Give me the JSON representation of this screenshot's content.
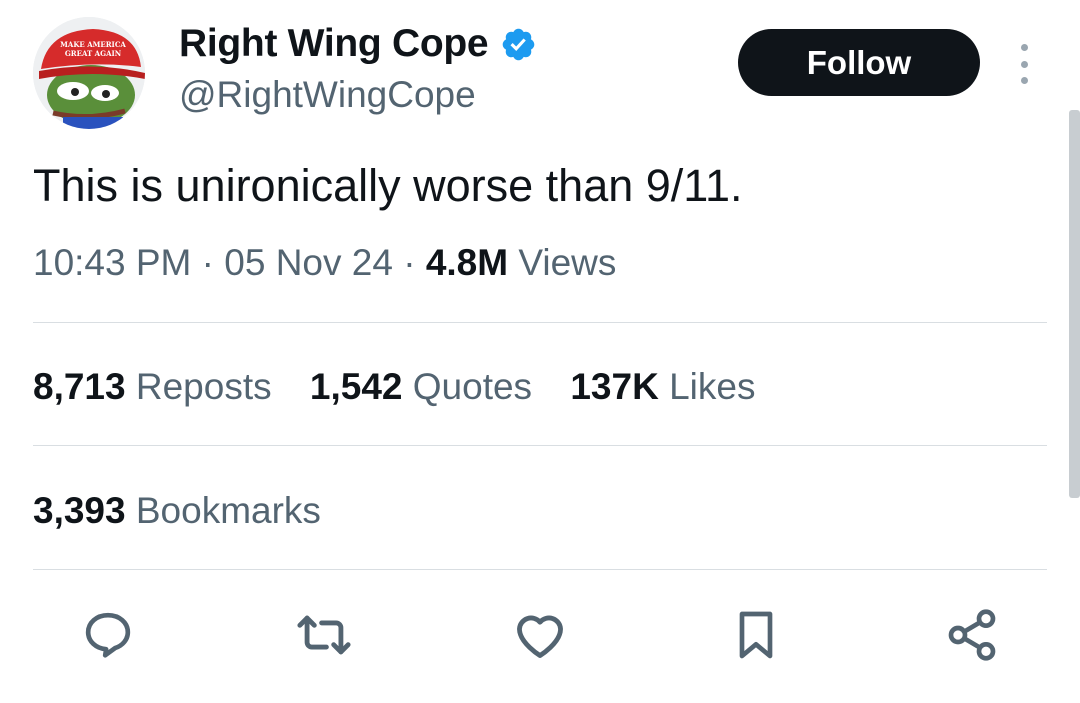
{
  "author": {
    "display_name": "Right Wing Cope",
    "handle": "@RightWingCope",
    "avatar_hat_text_line1": "MAKE AMERICA",
    "avatar_hat_text_line2": "GREAT AGAIN",
    "verified": true
  },
  "follow_button": {
    "label": "Follow"
  },
  "tweet": {
    "text": "This is unironically worse than 9/11.",
    "time": "10:43 PM",
    "separator": "·",
    "date": "05 Nov 24",
    "views_count": "4.8M",
    "views_label": "Views"
  },
  "stats": {
    "reposts": {
      "count": "8,713",
      "label": "Reposts"
    },
    "quotes": {
      "count": "1,542",
      "label": "Quotes"
    },
    "likes": {
      "count": "137K",
      "label": "Likes"
    },
    "bookmarks": {
      "count": "3,393",
      "label": "Bookmarks"
    }
  },
  "actions": [
    "reply-icon",
    "repost-icon",
    "like-icon",
    "bookmark-icon",
    "share-icon"
  ],
  "colors": {
    "text_primary": "#0f1419",
    "text_secondary": "#536471",
    "verified_blue": "#1d9bf0",
    "divider": "#d9dee2",
    "button_bg": "#0f1419"
  }
}
